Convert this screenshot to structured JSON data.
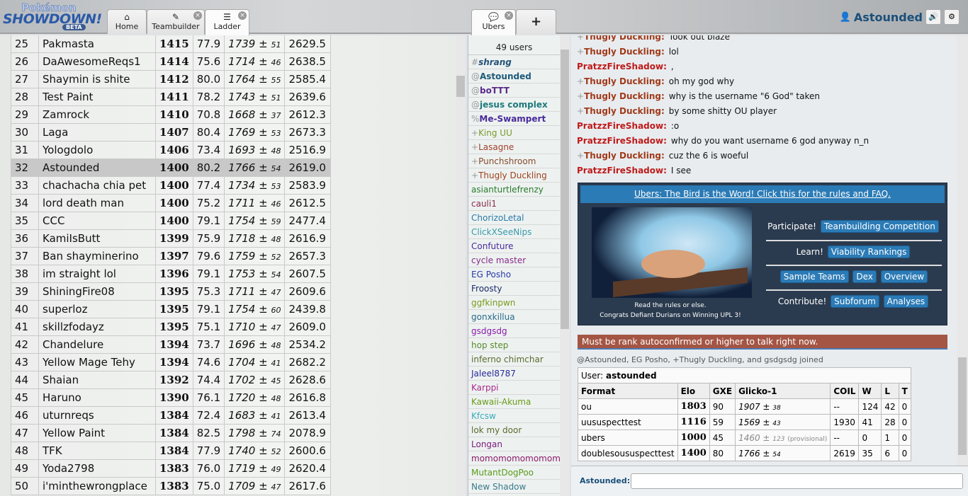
{
  "header": {
    "logo_top": "Pokémon",
    "logo_main": "SHOWDOWN!",
    "logo_badge": "BETA",
    "tabs": [
      {
        "label": "Home",
        "icon": "home-icon"
      },
      {
        "label": "Teambuilder",
        "icon": "edit-icon"
      },
      {
        "label": "Ladder",
        "icon": "list-icon"
      },
      {
        "label": "Ubers",
        "icon": "chat-bubble-icon"
      }
    ],
    "new_tab": "+",
    "username": "Astounded"
  },
  "ladder": {
    "rows": [
      [
        "25",
        "Pakmasta",
        "1415",
        "77.9",
        "1739",
        "51",
        "2629.5"
      ],
      [
        "26",
        "DaAwesomeReqs1",
        "1414",
        "75.6",
        "1714",
        "46",
        "2638.5"
      ],
      [
        "27",
        "Shaymin is shite",
        "1412",
        "80.0",
        "1764",
        "55",
        "2585.4"
      ],
      [
        "28",
        "Test Paint",
        "1411",
        "78.2",
        "1743",
        "51",
        "2639.6"
      ],
      [
        "29",
        "Zamrock",
        "1410",
        "70.8",
        "1668",
        "37",
        "2612.3"
      ],
      [
        "30",
        "Laga",
        "1407",
        "80.4",
        "1769",
        "53",
        "2673.3"
      ],
      [
        "31",
        "Yologdolo",
        "1406",
        "73.4",
        "1693",
        "48",
        "2516.9"
      ],
      [
        "32",
        "Astounded",
        "1400",
        "80.2",
        "1766",
        "54",
        "2619.0"
      ],
      [
        "33",
        "chachacha chia pet",
        "1400",
        "77.4",
        "1734",
        "53",
        "2583.9"
      ],
      [
        "34",
        "lord death man",
        "1400",
        "75.2",
        "1711",
        "46",
        "2612.5"
      ],
      [
        "35",
        "CCC",
        "1400",
        "79.1",
        "1754",
        "59",
        "2477.4"
      ],
      [
        "36",
        "KamiIsButt",
        "1399",
        "75.9",
        "1718",
        "48",
        "2616.9"
      ],
      [
        "37",
        "Ban shayminerino",
        "1397",
        "79.6",
        "1759",
        "52",
        "2657.3"
      ],
      [
        "38",
        "im straight lol",
        "1396",
        "79.1",
        "1753",
        "54",
        "2607.5"
      ],
      [
        "39",
        "ShiningFire08",
        "1395",
        "75.3",
        "1711",
        "47",
        "2609.6"
      ],
      [
        "40",
        "superloz",
        "1395",
        "79.1",
        "1754",
        "60",
        "2439.8"
      ],
      [
        "41",
        "skillzfodayz",
        "1395",
        "75.1",
        "1710",
        "47",
        "2609.0"
      ],
      [
        "42",
        "Chandelure",
        "1394",
        "73.7",
        "1696",
        "48",
        "2534.2"
      ],
      [
        "43",
        "Yellow Mage Tehy",
        "1394",
        "74.6",
        "1704",
        "41",
        "2682.2"
      ],
      [
        "44",
        "Shaian",
        "1392",
        "74.4",
        "1702",
        "45",
        "2628.6"
      ],
      [
        "45",
        "Haruno",
        "1390",
        "76.1",
        "1720",
        "48",
        "2616.8"
      ],
      [
        "46",
        "uturnreqs",
        "1384",
        "72.4",
        "1683",
        "41",
        "2613.4"
      ],
      [
        "47",
        "Yellow Paint",
        "1384",
        "82.5",
        "1798",
        "74",
        "2078.9"
      ],
      [
        "48",
        "TFK",
        "1384",
        "77.9",
        "1740",
        "52",
        "2600.6"
      ],
      [
        "49",
        "Yoda2798",
        "1383",
        "76.0",
        "1719",
        "49",
        "2620.4"
      ],
      [
        "50",
        "i'minthewrongplace",
        "1383",
        "75.0",
        "1709",
        "47",
        "2617.6"
      ]
    ],
    "highlight_rank": "32"
  },
  "userlist": {
    "count": "49 users",
    "users": [
      {
        "g": "#",
        "n": "shrang",
        "c": "#24527a",
        "auth": true,
        "it": true
      },
      {
        "g": "@",
        "n": "Astounded",
        "c": "#1d5a78",
        "auth": true
      },
      {
        "g": "@",
        "n": "boTTT",
        "c": "#5a2a8a",
        "auth": true
      },
      {
        "g": "@",
        "n": "jesus complex",
        "c": "#1f7a7a",
        "auth": true
      },
      {
        "g": "%",
        "n": "Me-Swampert",
        "c": "#4a2a9a",
        "auth": true
      },
      {
        "g": "+",
        "n": "King UU",
        "c": "#7a9a2a"
      },
      {
        "g": "+",
        "n": "Lasagne",
        "c": "#a0402a"
      },
      {
        "g": "+",
        "n": "Punchshroom",
        "c": "#8a4a2a"
      },
      {
        "g": "+",
        "n": "Thugly Duckling",
        "c": "#a0401a"
      },
      {
        "g": "",
        "n": "asianturtlefrenzy",
        "c": "#2a7a2a"
      },
      {
        "g": "",
        "n": "cauli1",
        "c": "#8a2a4a"
      },
      {
        "g": "",
        "n": "ChorizoLetal",
        "c": "#2a7aaa"
      },
      {
        "g": "",
        "n": "ClickXSeeNips",
        "c": "#3a9aaa"
      },
      {
        "g": "",
        "n": "Confuture",
        "c": "#4a2a9a"
      },
      {
        "g": "",
        "n": "cycle master",
        "c": "#8a2a8a"
      },
      {
        "g": "",
        "n": "EG Posho",
        "c": "#2a3aaa"
      },
      {
        "g": "",
        "n": "Froosty",
        "c": "#1a2a6a"
      },
      {
        "g": "",
        "n": "ggfkinpwn",
        "c": "#7a9a1a"
      },
      {
        "g": "",
        "n": "gonxkillua",
        "c": "#2a6a8a"
      },
      {
        "g": "",
        "n": "gsdgsdg",
        "c": "#8a1aaa"
      },
      {
        "g": "",
        "n": "hop step",
        "c": "#5a8a2a"
      },
      {
        "g": "",
        "n": "inferno chimchar",
        "c": "#5a6a2a"
      },
      {
        "g": "",
        "n": "Jaleel8787",
        "c": "#2a2a9a"
      },
      {
        "g": "",
        "n": "Karppi",
        "c": "#aa2a8a"
      },
      {
        "g": "",
        "n": "Kawaii-Akuma",
        "c": "#6a9a1a"
      },
      {
        "g": "",
        "n": "Kfcsw",
        "c": "#3aaaba"
      },
      {
        "g": "",
        "n": "lok my door",
        "c": "#5a6a2a"
      },
      {
        "g": "",
        "n": "Longan",
        "c": "#7a1a7a"
      },
      {
        "g": "",
        "n": "momomomomomomo",
        "c": "#8a1a6a"
      },
      {
        "g": "",
        "n": "MutantDogPoo",
        "c": "#5a9a1a"
      },
      {
        "g": "",
        "n": "New Shadow",
        "c": "#3a7a8a"
      }
    ]
  },
  "chat": {
    "messages": [
      {
        "g": "+",
        "who": "Thugly Duckling:",
        "c": "#a03a1a",
        "text": "Took out blaze"
      },
      {
        "g": "+",
        "who": "Thugly Duckling:",
        "c": "#a03a1a",
        "text": "lol"
      },
      {
        "g": "",
        "who": "PratzzFireShadow:",
        "c": "#c01a1a",
        "text": ","
      },
      {
        "g": "+",
        "who": "Thugly Duckling:",
        "c": "#a03a1a",
        "text": "oh my god why"
      },
      {
        "g": "+",
        "who": "Thugly Duckling:",
        "c": "#a03a1a",
        "text": "why is the username \"6 God\" taken"
      },
      {
        "g": "+",
        "who": "Thugly Duckling:",
        "c": "#a03a1a",
        "text": "by some shitty OU player"
      },
      {
        "g": "",
        "who": "PratzzFireShadow:",
        "c": "#c01a1a",
        "text": ":o"
      },
      {
        "g": "",
        "who": "PratzzFireShadow:",
        "c": "#c01a1a",
        "text": "why do you want username 6 god anyway n_n"
      },
      {
        "g": "+",
        "who": "Thugly Duckling:",
        "c": "#a03a1a",
        "text": "cuz the 6 is woeful"
      },
      {
        "g": "",
        "who": "PratzzFireShadow:",
        "c": "#c01a1a",
        "text": "I see"
      }
    ],
    "infobox": {
      "title": "Ubers: The Bird is the Word! Click this for the rules and FAQ.",
      "caption1": "Read the rules or else.",
      "caption2": "Congrats Defiant Durians on Winning UPL 3!",
      "participate": "Participate!",
      "teambuilding": "Teambuilding Competition",
      "learn": "Learn!",
      "viability": "Viability Rankings",
      "sample": "Sample Teams",
      "dex": "Dex",
      "overview": "Overview",
      "contribute": "Contribute!",
      "subforum": "Subforum",
      "analyses": "Analyses"
    },
    "notice": "Must be rank autoconfirmed or higher to talk right now.",
    "joined": "@Astounded, EG Posho, +Thugly Duckling, and gsdgsdg joined",
    "usertable": {
      "user_label": "User:",
      "user": "astounded",
      "headers": [
        "Format",
        "Elo",
        "GXE",
        "Glicko-1",
        "COIL",
        "W",
        "L",
        "T"
      ],
      "rows": [
        {
          "f": "ou",
          "elo": "1803",
          "gxe": "90",
          "gl": "1907",
          "dev": "38",
          "prov": "",
          "coil": "--",
          "w": "124",
          "l": "42",
          "t": "0"
        },
        {
          "f": "uususpecttest",
          "elo": "1116",
          "gxe": "59",
          "gl": "1569",
          "dev": "43",
          "prov": "",
          "coil": "1930",
          "w": "41",
          "l": "28",
          "t": "0"
        },
        {
          "f": "ubers",
          "elo": "1000",
          "gxe": "45",
          "gl": "1460",
          "dev": "123",
          "prov": "(provisional)",
          "coil": "--",
          "w": "0",
          "l": "1",
          "t": "0"
        },
        {
          "f": "doublesoususpecttest",
          "elo": "1400",
          "gxe": "80",
          "gl": "1766",
          "dev": "54",
          "prov": "",
          "coil": "2619",
          "w": "35",
          "l": "6",
          "t": "0"
        }
      ]
    },
    "input_label": "Astounded:",
    "input_value": ""
  }
}
